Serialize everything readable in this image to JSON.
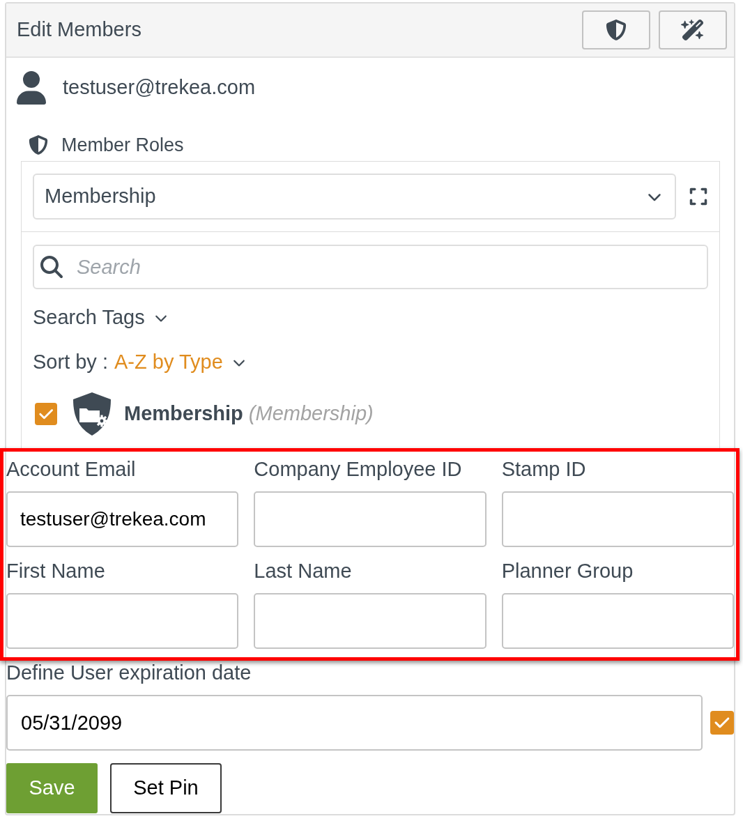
{
  "header": {
    "title": "Edit Members"
  },
  "user": {
    "email": "testuser@trekea.com"
  },
  "member_roles": {
    "heading": "Member Roles",
    "role_select": {
      "value": "Membership"
    },
    "search": {
      "placeholder": "Search"
    },
    "search_tags": {
      "label": "Search Tags"
    },
    "sort": {
      "label": "Sort by :",
      "value": "A-Z by Type"
    },
    "roles": [
      {
        "name": "Membership",
        "type": "(Membership)",
        "checked": true
      }
    ]
  },
  "fields_section": {
    "highlighted": true,
    "fields": [
      {
        "label": "Account Email",
        "value": "testuser@trekea.com"
      },
      {
        "label": "Company Employee ID"
      },
      {
        "label": "Stamp ID"
      },
      {
        "label": "First Name"
      },
      {
        "label": "Last Name"
      },
      {
        "label": "Planner Group"
      }
    ]
  },
  "expiration": {
    "label": "Define User expiration date",
    "value": "05/31/2099",
    "checked": true
  },
  "buttons": [
    {
      "label": "Save",
      "kind": "primary"
    },
    {
      "label": "Set Pin",
      "kind": "secondary"
    }
  ]
}
